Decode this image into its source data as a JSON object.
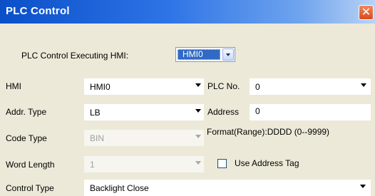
{
  "dialog": {
    "title": "PLC Control",
    "close_glyph": "✕"
  },
  "executing": {
    "label": "PLC Control Executing HMI:",
    "value": "HMI0"
  },
  "hmi": {
    "label": "HMI",
    "value": "HMI0"
  },
  "plc_no": {
    "label": "PLC No.",
    "value": "0"
  },
  "addr_type": {
    "label": "Addr. Type",
    "value": "LB"
  },
  "address": {
    "label": "Address",
    "value": "0"
  },
  "code_type": {
    "label": "Code Type",
    "value": "BIN"
  },
  "format": {
    "text": "Format(Range):DDDD (0--9999)"
  },
  "word_length": {
    "label": "Word Length",
    "value": "1"
  },
  "use_address_tag": {
    "label": "Use Address Tag",
    "checked": false
  },
  "control_type": {
    "label": "Control Type",
    "value": "Backlight Close"
  }
}
